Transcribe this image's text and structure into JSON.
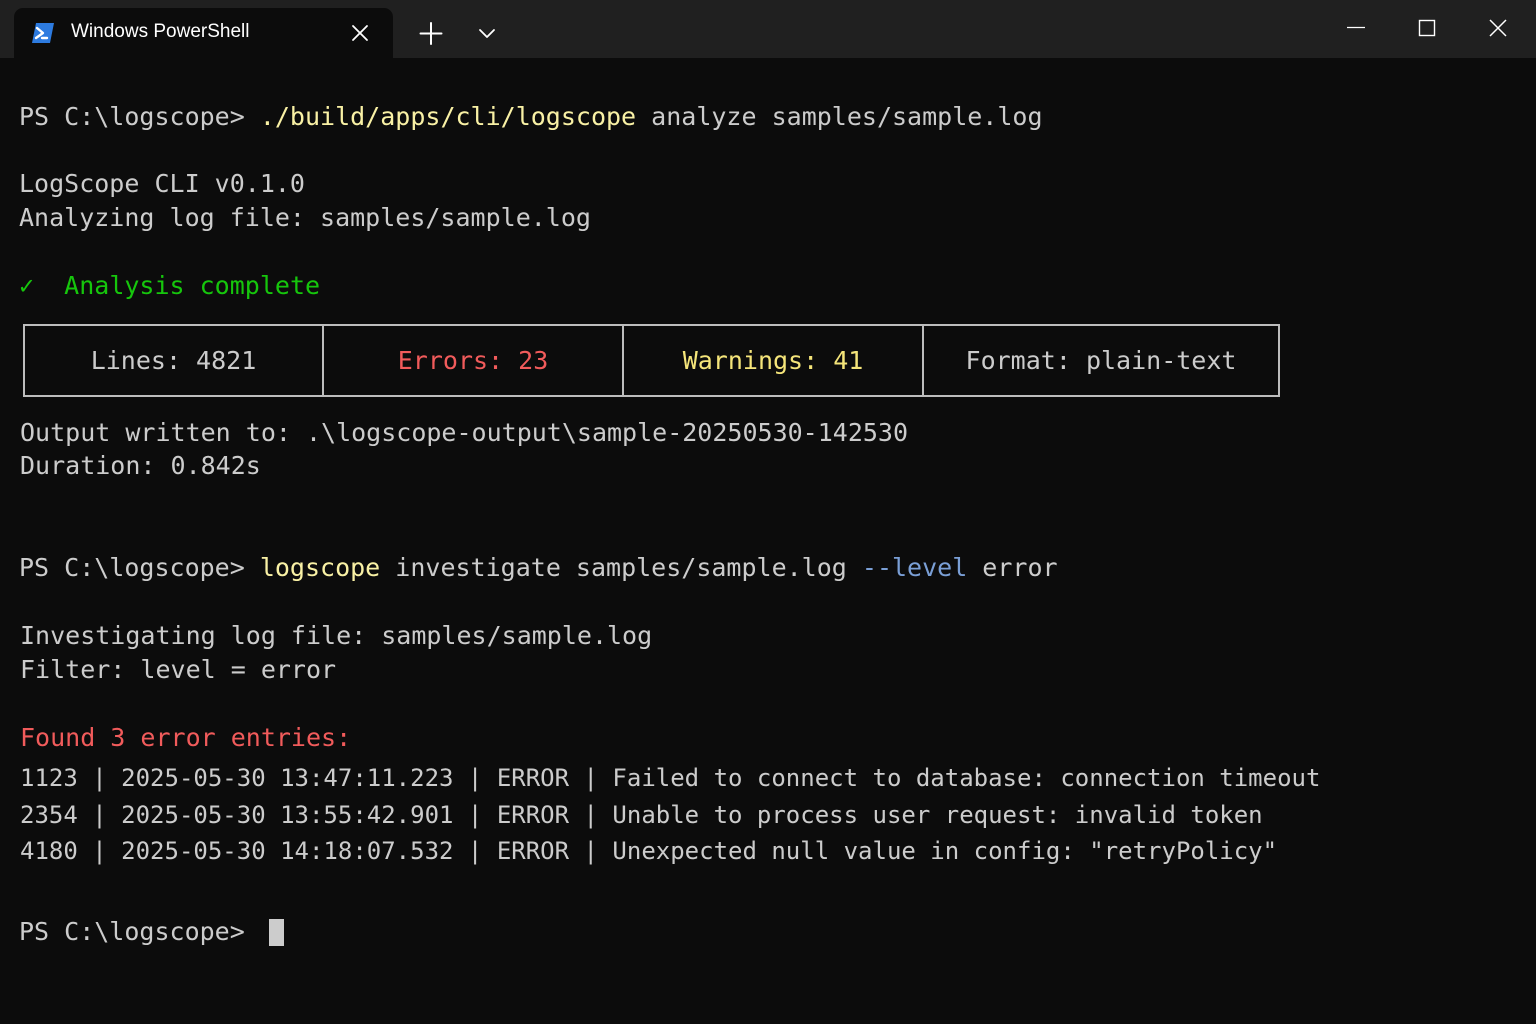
{
  "window": {
    "tab_title": "Windows PowerShell",
    "icons": {
      "tab": "powershell-icon",
      "close_tab": "close-icon",
      "new_tab": "plus-icon",
      "dropdown": "chevron-down-icon",
      "minimize": "minimize-icon",
      "maximize": "maximize-icon",
      "close": "close-icon"
    }
  },
  "colors": {
    "background": "#0c0c0c",
    "titlebar": "#202020",
    "text": "#cccccc",
    "command": "#f9f1a5",
    "parameter": "#7a9fd6",
    "success": "#16c60c",
    "error": "#e74856"
  },
  "terminal": {
    "cmd1": {
      "prompt": "PS C:\\logscope> ",
      "exe": "./build/apps/cli/logscope",
      "args": " analyze samples/sample.log"
    },
    "version_line": "LogScope CLI v0.1.0",
    "analyzing_line": "Analyzing log file: samples/sample.log",
    "check_mark": "✓",
    "complete_line": "Analysis complete",
    "summary": {
      "lines": "Lines: 4821",
      "errors": "Errors: 23",
      "warnings": "Warnings: 41",
      "format": "Format: plain-text"
    },
    "output_line": "Output written to: .\\logscope-output\\sample-20250530-142530",
    "duration_line": "Duration: 0.842s",
    "cmd2": {
      "prompt": "PS C:\\logscope> ",
      "exe": "logscope",
      "args": " investigate samples/sample.log ",
      "flag": "--level",
      "flag_value": " error"
    },
    "investigating_line": "Investigating log file: samples/sample.log",
    "filter_line": "Filter: level = error",
    "found_line": "Found 3 error entries:",
    "entries": [
      "1123 | 2025-05-30 13:47:11.223 | ERROR | Failed to connect to database: connection timeout",
      "2354 | 2025-05-30 13:55:42.901 | ERROR | Unable to process user request: invalid token",
      "4180 | 2025-05-30 14:18:07.532 | ERROR | Unexpected null value in config: \"retryPolicy\""
    ],
    "final_prompt": "PS C:\\logscope> "
  }
}
